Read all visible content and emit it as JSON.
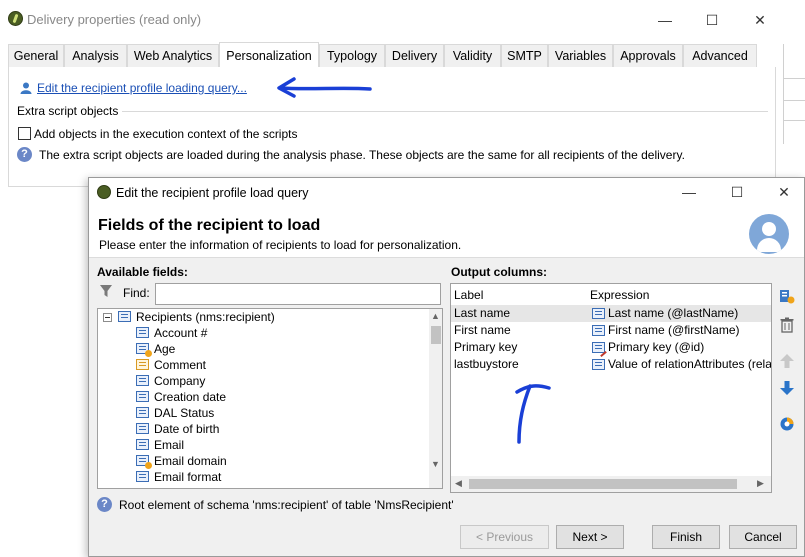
{
  "main_window": {
    "title": "Delivery properties (read only)",
    "controls": {
      "minimize": "—",
      "maximize": "☐",
      "close": "✕"
    }
  },
  "tabs": [
    {
      "label": "General"
    },
    {
      "label": "Analysis"
    },
    {
      "label": "Web Analytics"
    },
    {
      "label": "Personalization",
      "active": true
    },
    {
      "label": "Typology"
    },
    {
      "label": "Delivery"
    },
    {
      "label": "Validity"
    },
    {
      "label": "SMTP"
    },
    {
      "label": "Variables"
    },
    {
      "label": "Approvals"
    },
    {
      "label": "Advanced"
    }
  ],
  "personalization": {
    "edit_link": "Edit the recipient profile loading query...",
    "extra_scripts_label": "Extra script objects",
    "add_objects_label": "Add objects in the execution context of the scripts",
    "add_objects_checked": false,
    "info_text": "The extra script objects are loaded during the analysis phase. These objects are the same for all recipients of the delivery."
  },
  "dialog": {
    "title": "Edit the recipient profile load query",
    "heading": "Fields of the recipient to load",
    "subheading": "Please enter the information of recipients to load for personalization.",
    "available_label": "Available fields:",
    "find_label": "Find:",
    "find_value": "",
    "tree_root": "Recipients (nms:recipient)",
    "tree_items": [
      {
        "label": "Account #",
        "icon": "field-icon"
      },
      {
        "label": "Age",
        "icon": "computed-field-icon"
      },
      {
        "label": "Comment",
        "icon": "memo-field-icon"
      },
      {
        "label": "Company",
        "icon": "field-icon"
      },
      {
        "label": "Creation date",
        "icon": "field-icon"
      },
      {
        "label": "DAL Status",
        "icon": "field-icon"
      },
      {
        "label": "Date of birth",
        "icon": "field-icon"
      },
      {
        "label": "Email",
        "icon": "field-icon"
      },
      {
        "label": "Email domain",
        "icon": "computed-field-icon"
      },
      {
        "label": "Email format",
        "icon": "field-icon"
      }
    ],
    "output_label": "Output columns:",
    "output_headers": {
      "label": "Label",
      "expression": "Expression"
    },
    "output_rows": [
      {
        "label": "Last name",
        "expression": "Last name (@lastName)",
        "icon": "field-icon"
      },
      {
        "label": "First name",
        "expression": "First name (@firstName)",
        "icon": "field-icon"
      },
      {
        "label": "Primary key",
        "expression": "Primary key (@id)",
        "icon": "key-field-icon"
      },
      {
        "label": "lastbuystore",
        "expression": "Value of relationAttributes (rela",
        "icon": "field-icon"
      }
    ],
    "status_text": "Root element of schema 'nms:recipient' of table 'NmsRecipient'",
    "buttons": {
      "previous": "< Previous",
      "next": "Next >",
      "finish": "Finish",
      "cancel": "Cancel"
    }
  },
  "colors": {
    "link": "#1a4fb5",
    "annotation_ink": "#1a3fd6",
    "avatar": "#7fa7d8"
  }
}
